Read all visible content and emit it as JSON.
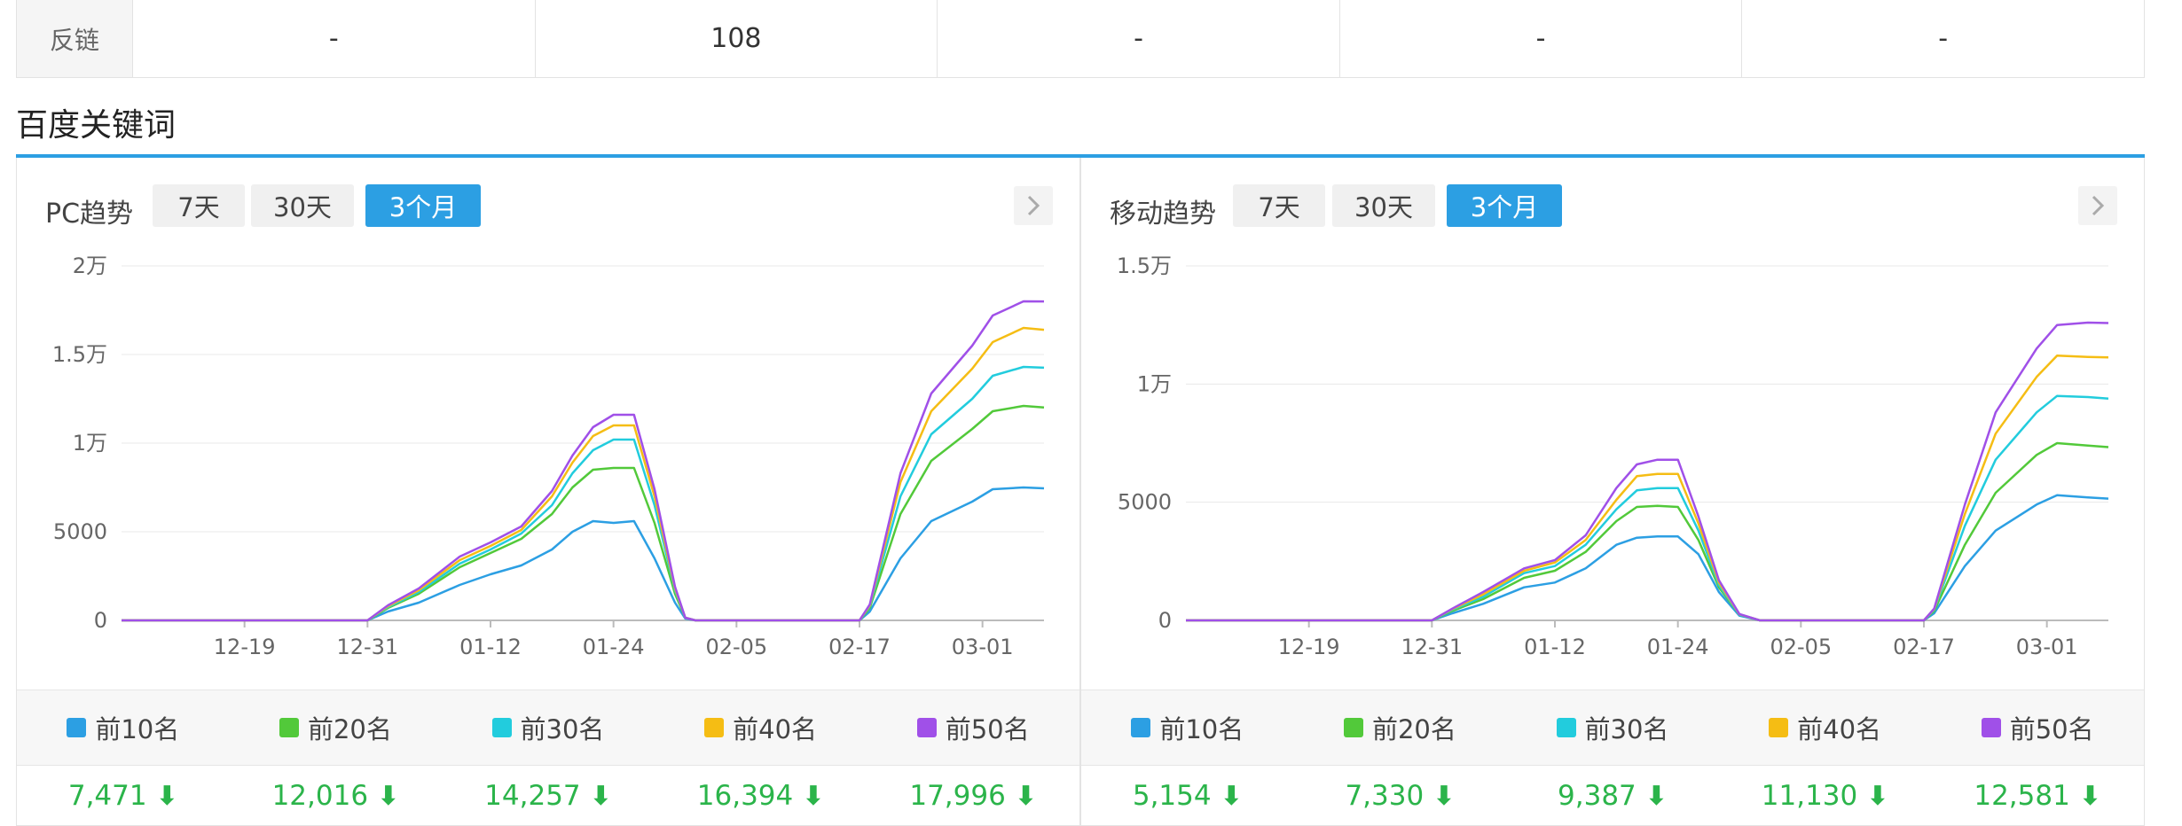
{
  "backlink": {
    "label": "反链",
    "values": [
      "-",
      "108",
      "-",
      "-",
      "-"
    ]
  },
  "section_title": "百度关键词",
  "tabs": [
    "7天",
    "30天",
    "3个月"
  ],
  "active_tab": 2,
  "colors": {
    "top10": "#2c9fe3",
    "top20": "#52c93a",
    "top30": "#22ccdd",
    "top40": "#f5bd14",
    "top50": "#a050e8",
    "accent": "#2c9fe3",
    "down": "#2bb44a"
  },
  "chart_data": [
    {
      "type": "line",
      "title": "PC趋势",
      "x_ticks": [
        "12-19",
        "12-31",
        "01-12",
        "01-24",
        "02-05",
        "02-17",
        "03-01"
      ],
      "y_ticks": [
        "0",
        "5000",
        "1万",
        "1.5万",
        "2万"
      ],
      "ylim": [
        0,
        20000
      ],
      "n": 90,
      "grid": true,
      "series": [
        {
          "name": "前10名",
          "final": "7,471",
          "points": [
            [
              0,
              0
            ],
            [
              24,
              0
            ],
            [
              26,
              500
            ],
            [
              29,
              1000
            ],
            [
              33,
              2000
            ],
            [
              36,
              2600
            ],
            [
              39,
              3100
            ],
            [
              42,
              4000
            ],
            [
              44,
              5000
            ],
            [
              46,
              5600
            ],
            [
              48,
              5500
            ],
            [
              50,
              5600
            ],
            [
              52,
              3500
            ],
            [
              54,
              1000
            ],
            [
              55,
              100
            ],
            [
              56,
              0
            ],
            [
              72,
              0
            ],
            [
              73,
              500
            ],
            [
              76,
              3500
            ],
            [
              79,
              5600
            ],
            [
              83,
              6700
            ],
            [
              85,
              7400
            ],
            [
              88,
              7500
            ],
            [
              90,
              7450
            ]
          ]
        },
        {
          "name": "前20名",
          "final": "12,016",
          "points": [
            [
              0,
              0
            ],
            [
              24,
              0
            ],
            [
              26,
              700
            ],
            [
              29,
              1500
            ],
            [
              33,
              3000
            ],
            [
              36,
              3800
            ],
            [
              39,
              4600
            ],
            [
              42,
              6000
            ],
            [
              44,
              7500
            ],
            [
              46,
              8500
            ],
            [
              48,
              8600
            ],
            [
              50,
              8600
            ],
            [
              52,
              5500
            ],
            [
              54,
              1500
            ],
            [
              55,
              150
            ],
            [
              56,
              0
            ],
            [
              72,
              0
            ],
            [
              73,
              700
            ],
            [
              76,
              6000
            ],
            [
              79,
              9000
            ],
            [
              83,
              10800
            ],
            [
              85,
              11800
            ],
            [
              88,
              12100
            ],
            [
              90,
              12016
            ]
          ]
        },
        {
          "name": "前30名",
          "final": "14,257",
          "points": [
            [
              0,
              0
            ],
            [
              24,
              0
            ],
            [
              26,
              750
            ],
            [
              29,
              1600
            ],
            [
              33,
              3200
            ],
            [
              36,
              4000
            ],
            [
              39,
              4900
            ],
            [
              42,
              6500
            ],
            [
              44,
              8300
            ],
            [
              46,
              9600
            ],
            [
              48,
              10200
            ],
            [
              50,
              10200
            ],
            [
              52,
              6500
            ],
            [
              54,
              1700
            ],
            [
              55,
              150
            ],
            [
              56,
              0
            ],
            [
              72,
              0
            ],
            [
              73,
              800
            ],
            [
              76,
              7000
            ],
            [
              79,
              10500
            ],
            [
              83,
              12500
            ],
            [
              85,
              13800
            ],
            [
              88,
              14300
            ],
            [
              90,
              14257
            ]
          ]
        },
        {
          "name": "前40名",
          "final": "16,394",
          "points": [
            [
              0,
              0
            ],
            [
              24,
              0
            ],
            [
              26,
              800
            ],
            [
              29,
              1700
            ],
            [
              33,
              3400
            ],
            [
              36,
              4200
            ],
            [
              39,
              5100
            ],
            [
              42,
              7000
            ],
            [
              44,
              8900
            ],
            [
              46,
              10400
            ],
            [
              48,
              11000
            ],
            [
              50,
              11000
            ],
            [
              52,
              7000
            ],
            [
              54,
              1800
            ],
            [
              55,
              150
            ],
            [
              56,
              0
            ],
            [
              72,
              0
            ],
            [
              73,
              850
            ],
            [
              76,
              7800
            ],
            [
              79,
              11800
            ],
            [
              83,
              14200
            ],
            [
              85,
              15700
            ],
            [
              88,
              16500
            ],
            [
              90,
              16394
            ]
          ]
        },
        {
          "name": "前50名",
          "final": "17,996",
          "points": [
            [
              0,
              0
            ],
            [
              24,
              0
            ],
            [
              26,
              850
            ],
            [
              29,
              1800
            ],
            [
              33,
              3600
            ],
            [
              36,
              4400
            ],
            [
              39,
              5300
            ],
            [
              42,
              7300
            ],
            [
              44,
              9300
            ],
            [
              46,
              10900
            ],
            [
              48,
              11600
            ],
            [
              50,
              11600
            ],
            [
              52,
              7400
            ],
            [
              54,
              1900
            ],
            [
              55,
              150
            ],
            [
              56,
              0
            ],
            [
              72,
              0
            ],
            [
              73,
              900
            ],
            [
              76,
              8300
            ],
            [
              79,
              12800
            ],
            [
              83,
              15500
            ],
            [
              85,
              17200
            ],
            [
              88,
              18000
            ],
            [
              90,
              17996
            ]
          ]
        }
      ]
    },
    {
      "type": "line",
      "title": "移动趋势",
      "x_ticks": [
        "12-19",
        "12-31",
        "01-12",
        "01-24",
        "02-05",
        "02-17",
        "03-01"
      ],
      "y_ticks": [
        "0",
        "5000",
        "1万",
        "1.5万"
      ],
      "ylim": [
        0,
        15000
      ],
      "n": 90,
      "grid": true,
      "series": [
        {
          "name": "前10名",
          "final": "5,154",
          "points": [
            [
              0,
              0
            ],
            [
              24,
              0
            ],
            [
              26,
              300
            ],
            [
              29,
              700
            ],
            [
              33,
              1400
            ],
            [
              36,
              1600
            ],
            [
              39,
              2200
            ],
            [
              42,
              3200
            ],
            [
              44,
              3500
            ],
            [
              46,
              3550
            ],
            [
              48,
              3550
            ],
            [
              50,
              2800
            ],
            [
              52,
              1200
            ],
            [
              54,
              200
            ],
            [
              56,
              0
            ],
            [
              72,
              0
            ],
            [
              73,
              300
            ],
            [
              76,
              2300
            ],
            [
              79,
              3800
            ],
            [
              83,
              4900
            ],
            [
              85,
              5300
            ],
            [
              88,
              5200
            ],
            [
              90,
              5154
            ]
          ]
        },
        {
          "name": "前20名",
          "final": "7,330",
          "points": [
            [
              0,
              0
            ],
            [
              24,
              0
            ],
            [
              26,
              400
            ],
            [
              29,
              900
            ],
            [
              33,
              1800
            ],
            [
              36,
              2100
            ],
            [
              39,
              2900
            ],
            [
              42,
              4200
            ],
            [
              44,
              4800
            ],
            [
              46,
              4850
            ],
            [
              48,
              4800
            ],
            [
              50,
              3400
            ],
            [
              52,
              1400
            ],
            [
              54,
              250
            ],
            [
              56,
              0
            ],
            [
              72,
              0
            ],
            [
              73,
              400
            ],
            [
              76,
              3200
            ],
            [
              79,
              5400
            ],
            [
              83,
              7000
            ],
            [
              85,
              7500
            ],
            [
              88,
              7400
            ],
            [
              90,
              7330
            ]
          ]
        },
        {
          "name": "前30名",
          "final": "9,387",
          "points": [
            [
              0,
              0
            ],
            [
              24,
              0
            ],
            [
              26,
              450
            ],
            [
              29,
              1000
            ],
            [
              33,
              2000
            ],
            [
              36,
              2300
            ],
            [
              39,
              3200
            ],
            [
              42,
              4700
            ],
            [
              44,
              5500
            ],
            [
              46,
              5600
            ],
            [
              48,
              5600
            ],
            [
              50,
              3800
            ],
            [
              52,
              1500
            ],
            [
              54,
              250
            ],
            [
              56,
              0
            ],
            [
              72,
              0
            ],
            [
              73,
              450
            ],
            [
              76,
              4000
            ],
            [
              79,
              6800
            ],
            [
              83,
              8800
            ],
            [
              85,
              9500
            ],
            [
              88,
              9450
            ],
            [
              90,
              9387
            ]
          ]
        },
        {
          "name": "前40名",
          "final": "11,130",
          "points": [
            [
              0,
              0
            ],
            [
              24,
              0
            ],
            [
              26,
              480
            ],
            [
              29,
              1100
            ],
            [
              33,
              2100
            ],
            [
              36,
              2450
            ],
            [
              39,
              3400
            ],
            [
              42,
              5100
            ],
            [
              44,
              6100
            ],
            [
              46,
              6200
            ],
            [
              48,
              6200
            ],
            [
              50,
              4100
            ],
            [
              52,
              1600
            ],
            [
              54,
              260
            ],
            [
              56,
              0
            ],
            [
              72,
              0
            ],
            [
              73,
              480
            ],
            [
              76,
              4500
            ],
            [
              79,
              7900
            ],
            [
              83,
              10300
            ],
            [
              85,
              11200
            ],
            [
              88,
              11150
            ],
            [
              90,
              11130
            ]
          ]
        },
        {
          "name": "前50名",
          "final": "12,581",
          "points": [
            [
              0,
              0
            ],
            [
              24,
              0
            ],
            [
              26,
              500
            ],
            [
              29,
              1200
            ],
            [
              33,
              2200
            ],
            [
              36,
              2550
            ],
            [
              39,
              3600
            ],
            [
              42,
              5600
            ],
            [
              44,
              6600
            ],
            [
              46,
              6800
            ],
            [
              48,
              6800
            ],
            [
              50,
              4400
            ],
            [
              52,
              1700
            ],
            [
              54,
              270
            ],
            [
              56,
              0
            ],
            [
              72,
              0
            ],
            [
              73,
              500
            ],
            [
              76,
              4900
            ],
            [
              79,
              8800
            ],
            [
              83,
              11500
            ],
            [
              85,
              12500
            ],
            [
              88,
              12600
            ],
            [
              90,
              12581
            ]
          ]
        }
      ]
    }
  ]
}
